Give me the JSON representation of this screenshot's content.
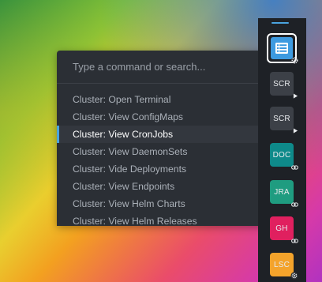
{
  "command_palette": {
    "placeholder": "Type a command or search...",
    "items": [
      {
        "label": "Cluster: Open Terminal"
      },
      {
        "label": "Cluster: View ConfigMaps"
      },
      {
        "label": "Cluster: View CronJobs"
      },
      {
        "label": "Cluster: View DaemonSets"
      },
      {
        "label": "Cluster: Vide Deployments"
      },
      {
        "label": "Cluster: View Endpoints"
      },
      {
        "label": "Cluster: View Helm Charts"
      },
      {
        "label": "Cluster: View Helm Releases"
      }
    ],
    "active_index": 2
  },
  "dock": {
    "items": [
      {
        "label": "",
        "icon": "cluster-list-icon",
        "color": "#3d9ae0",
        "badge": "settings-icon",
        "selected": true
      },
      {
        "label": "SCR",
        "color": "#3c4047",
        "badge": "play-icon"
      },
      {
        "label": "SCR",
        "color": "#3c4047",
        "badge": "play-icon"
      },
      {
        "label": "DOC",
        "color": "#0e8a8a",
        "badge": "link-icon"
      },
      {
        "label": "JRA",
        "color": "#1f9c80",
        "badge": "link-icon"
      },
      {
        "label": "GH",
        "color": "#e0205f",
        "badge": "link-icon"
      },
      {
        "label": "LSC",
        "color": "#f4a32b",
        "badge": "settings-icon"
      }
    ]
  },
  "colors": {
    "accent": "#4aa3df",
    "palette_bg": "#2b2f35",
    "dock_bg": "#1e2126"
  }
}
